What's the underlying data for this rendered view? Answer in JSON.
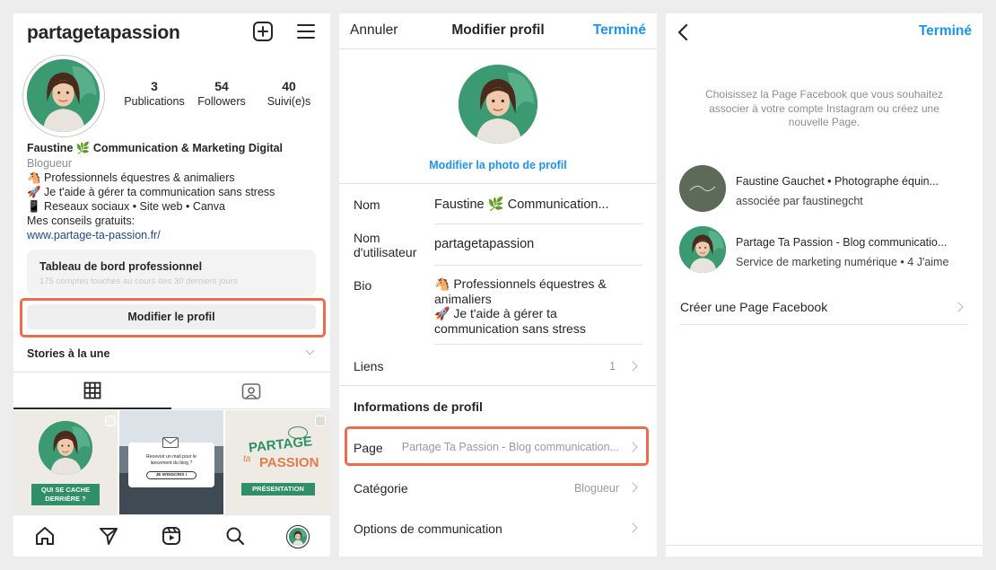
{
  "profile": {
    "username": "partagetapassion",
    "stats": [
      {
        "value": "3",
        "label": "Publications"
      },
      {
        "value": "54",
        "label": "Followers"
      },
      {
        "value": "40",
        "label": "Suivi(e)s"
      }
    ],
    "display_name": "Faustine 🌿 Communication & Marketing Digital",
    "category": "Blogueur",
    "bio_lines": [
      "🐴 Professionnels équestres & animaliers",
      "🚀 Je t'aide à gérer ta communication sans stress",
      "📱 Reseaux sociaux • Site web • Canva",
      "Mes conseils gratuits:"
    ],
    "link": "www.partage-ta-passion.fr/",
    "dashboard_title": "Tableau de bord professionnel",
    "dashboard_sub": "175 comptes touchés au cours des 30 derniers jours",
    "edit_button": "Modifier le profil",
    "stories_label": "Stories à la une",
    "posts": [
      {
        "caption": "QUI SE CACHE DERRIÈRE ?"
      },
      {
        "line1": "Recevoir un mail pour le lancement du blog ?",
        "cta": "JE M'INSCRIS !"
      },
      {
        "logo1": "PARTAGE",
        "logo2": "ta",
        "logo3": "PASSION",
        "caption": "PRÉSENTATION"
      }
    ]
  },
  "edit": {
    "cancel": "Annuler",
    "title": "Modifier profil",
    "done": "Terminé",
    "change_photo": "Modifier la photo de profil",
    "name_label": "Nom",
    "name_value": "Faustine 🌿 Communication...",
    "username_label1": "Nom",
    "username_label2": "d'utilisateur",
    "username_value": "partagetapassion",
    "bio_label": "Bio",
    "bio_lines": [
      "🐴 Professionnels équestres &",
      "animaliers",
      "🚀 Je t'aide à gérer ta",
      "communication sans stress"
    ],
    "links_label": "Liens",
    "links_count": "1",
    "section_title": "Informations de profil",
    "page_label": "Page",
    "page_value": "Partage Ta Passion - Blog communication...",
    "category_label": "Catégorie",
    "category_value": "Blogueur",
    "options_label": "Options de communication"
  },
  "fb": {
    "done": "Terminé",
    "intro": "Choisissez la Page Facebook que vous souhaitez associer à votre compte Instagram ou créez une nouvelle Page.",
    "pages": [
      {
        "name": "Faustine Gauchet • Photographe équin...",
        "sub": "associée par faustinegcht"
      },
      {
        "name": "Partage Ta Passion - Blog communicatio...",
        "sub": "Service de marketing numérique • 4 J'aime"
      }
    ],
    "create": "Créer une Page Facebook"
  },
  "colors": {
    "accent": "#1a95f0",
    "highlight": "#ef6b4f",
    "brand_green": "#2f8f67"
  }
}
